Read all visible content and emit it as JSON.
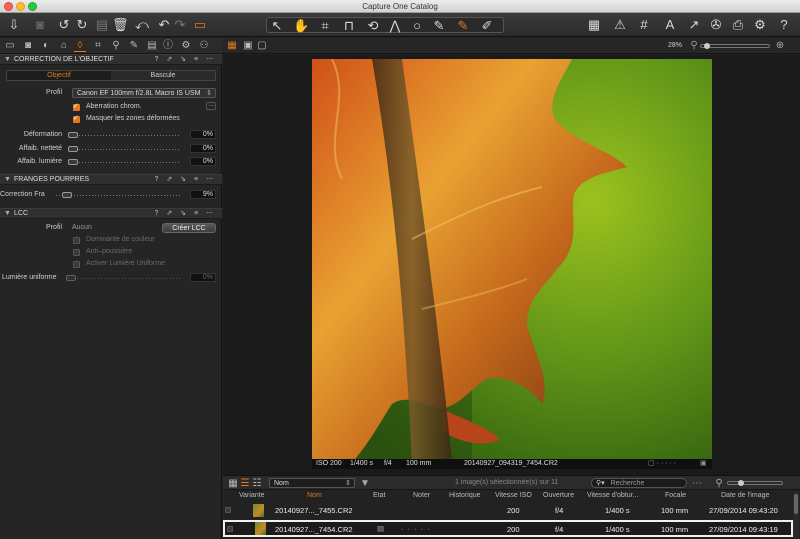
{
  "window": {
    "title": "Capture One Catalog"
  },
  "viewer": {
    "zoom": "28%"
  },
  "lens_section": {
    "title": "CORRECTION DE L'OBJECTIF",
    "tabs": [
      "Objectif",
      "Bascule"
    ],
    "profile_label": "Profil",
    "profile_value": "Canon EF 100mm f/2.8L Macro IS USM",
    "chk_chromatic": "Aberration chrom.",
    "chk_hide": "Masquer les zones déformées",
    "sliders": [
      {
        "label": "Déformation",
        "value": "0%"
      },
      {
        "label": "Affaib. netteté",
        "value": "0%"
      },
      {
        "label": "Affaib. lumière",
        "value": "0%"
      }
    ]
  },
  "fringe_section": {
    "title": "FRANGES POURPRES",
    "slider_label": "Correction Fra",
    "value": "9%"
  },
  "lcc_section": {
    "title": "LCC",
    "profile_label": "Profil",
    "profile_value": "Aucun",
    "create_button": "Créer LCC",
    "options": [
      "Dominante de couleur",
      "Anti–poussière",
      "Activer Lumière Uniforme"
    ],
    "uniform_label": "Lumière uniforme",
    "uniform_value": "0%"
  },
  "image_info": {
    "iso": "ISO 200",
    "shutter": "1/400 s",
    "aperture": "f/4",
    "focal": "100 mm",
    "filename": "20140927_094319_7454.CR2"
  },
  "browser": {
    "sort_value": "Nom",
    "selection_status": "1 image(s) sélectionnée(s) sur 11",
    "search_placeholder": "Recherche",
    "columns": [
      "Variante",
      "Nom",
      "Etat",
      "Noter",
      "Historique",
      "Vitesse ISO",
      "Ouverture",
      "Vitesse d'obtur...",
      "Focale",
      "Date de l'image"
    ],
    "rows": [
      {
        "name": "20140927..._7455.CR2",
        "iso": "200",
        "aperture": "f/4",
        "shutter": "1/400 s",
        "focal": "100 mm",
        "date": "27/09/2014 09:43:20",
        "stars": ""
      },
      {
        "name": "20140927..._7454.CR2",
        "iso": "200",
        "aperture": "f/4",
        "shutter": "1/400 s",
        "focal": "100 mm",
        "date": "27/09/2014 09:43:19",
        "stars": "· · · · ·"
      }
    ]
  },
  "colors": {
    "accent": "#e07a1f",
    "panel": "#252525"
  }
}
